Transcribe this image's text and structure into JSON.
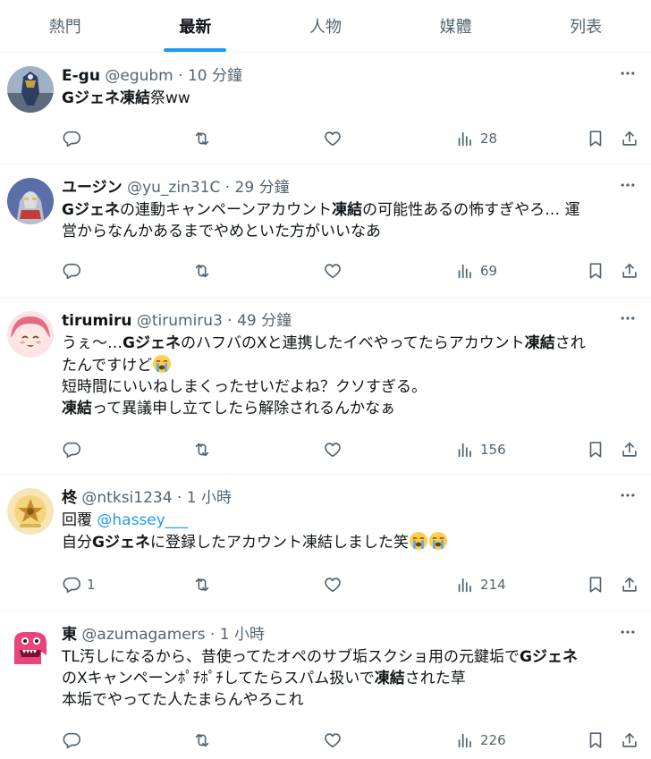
{
  "tabs": [
    {
      "label": "熱門",
      "active": false
    },
    {
      "label": "最新",
      "active": true
    },
    {
      "label": "人物",
      "active": false
    },
    {
      "label": "媒體",
      "active": false
    },
    {
      "label": "列表",
      "active": false
    }
  ],
  "colors": {
    "accent": "#1d9bf0",
    "text": "#0f1419",
    "muted": "#536471",
    "divider": "#eff3f4"
  },
  "icons": [
    "reply-icon",
    "retweet-icon",
    "like-icon",
    "views-icon",
    "bookmark-icon",
    "share-icon",
    "more-icon",
    "crying-emoji"
  ],
  "tweets": [
    {
      "name": "E-gu",
      "handle": "@egubm",
      "time": "· 10 分鐘",
      "lines": [
        [
          {
            "t": "Gジェネ凍結",
            "b": true
          },
          {
            "t": "祭ww"
          }
        ]
      ],
      "replies": "",
      "views": "28"
    },
    {
      "name": "ユージン",
      "handle": "@yu_zin31C",
      "time": "· 29 分鐘",
      "lines": [
        [
          {
            "t": "Gジェネ",
            "b": true
          },
          {
            "t": "の連動キャンペーンアカウント"
          },
          {
            "t": "凍結",
            "b": true
          },
          {
            "t": "の可能性あるの怖すぎやろ… 運"
          }
        ],
        [
          {
            "t": "営からなんかあるまでやめといた方がいいなあ"
          }
        ]
      ],
      "replies": "",
      "views": "69"
    },
    {
      "name": "tirumiru",
      "handle": "@tirumiru3",
      "time": "· 49 分鐘",
      "lines": [
        [
          {
            "t": "うぇ～…"
          },
          {
            "t": "Gジェネ",
            "b": true
          },
          {
            "t": "のハフバのXと連携したイベやってたらアカウント"
          },
          {
            "t": "凍結",
            "b": true
          },
          {
            "t": "され"
          }
        ],
        [
          {
            "t": "たんですけど"
          },
          {
            "emoji": "crying"
          }
        ],
        [
          {
            "t": "短時間にいいねしまくったせいだよね？クソすぎる。"
          }
        ],
        [
          {
            "t": "凍結",
            "b": true
          },
          {
            "t": "って異議申し立てしたら解除されるんかなぁ"
          }
        ]
      ],
      "replies": "",
      "views": "156"
    },
    {
      "name": "柊",
      "handle": "@ntksi1234",
      "time": "· 1 小時",
      "lines": [
        [
          {
            "t": "回覆 "
          },
          {
            "t": "@hassey___",
            "link": true
          }
        ],
        [
          {
            "t": "自分"
          },
          {
            "t": "Gジェネ",
            "b": true
          },
          {
            "t": "に登録したアカウント凍結しました笑"
          },
          {
            "emoji": "crying"
          },
          {
            "emoji": "crying"
          }
        ]
      ],
      "replies": "1",
      "views": "214"
    },
    {
      "name": "東",
      "handle": "@azumagamers",
      "time": "· 1 小時",
      "lines": [
        [
          {
            "t": "TL汚しになるから、昔使ってたオペのサブ垢スクショ用の元鍵垢で"
          },
          {
            "t": "Gジェネ",
            "b": true
          }
        ],
        [
          {
            "t": "のXキャンペーンﾎﾟﾁﾎﾟﾁしてたらスパム扱いで"
          },
          {
            "t": "凍結",
            "b": true
          },
          {
            "t": "された草"
          }
        ],
        [
          {
            "t": "本垢でやってた人たまらんやろこれ"
          }
        ]
      ],
      "replies": "",
      "views": "226"
    }
  ]
}
